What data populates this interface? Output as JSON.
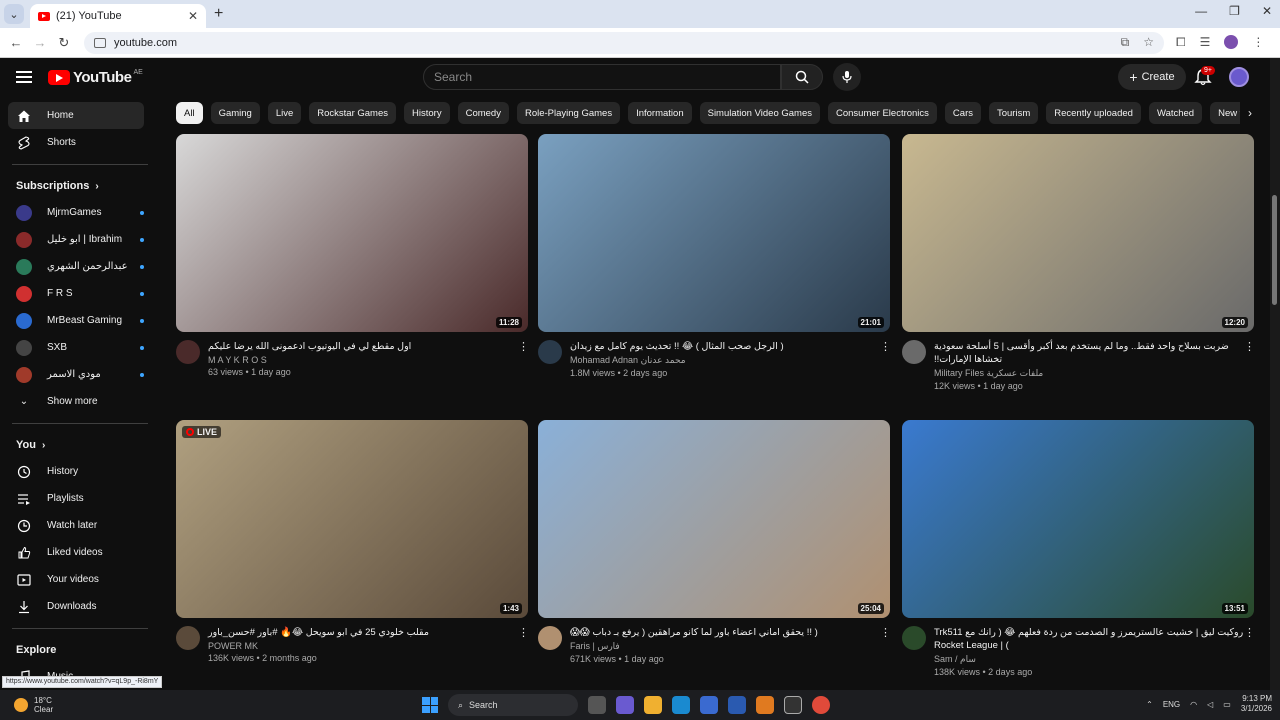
{
  "browser": {
    "tab_title": "(21) YouTube",
    "url": "youtube.com",
    "status_url": "https://www.youtube.com/watch?v=qL9p_-Ri8mY"
  },
  "header": {
    "logo": "YouTube",
    "country": "AE",
    "search_placeholder": "Search",
    "create_label": "Create",
    "notification_count": "9+"
  },
  "sidebar": {
    "main": [
      {
        "label": "Home",
        "icon": "home-icon"
      },
      {
        "label": "Shorts",
        "icon": "shorts-icon"
      }
    ],
    "subscriptions_title": "Subscriptions",
    "subscriptions": [
      {
        "label": "MjrmGames",
        "color": "#3a3a8a"
      },
      {
        "label": "ابو خليل | Ibrahim",
        "color": "#8a2a2a"
      },
      {
        "label": "عبدالرحمن الشهري",
        "color": "#2a7a5a"
      },
      {
        "label": "F R S",
        "color": "#d03030"
      },
      {
        "label": "MrBeast Gaming",
        "color": "#2a6ad0"
      },
      {
        "label": "SXB",
        "color": "#444"
      },
      {
        "label": "مودي الاسمر",
        "color": "#a03a2a"
      }
    ],
    "show_more": "Show more",
    "you_title": "You",
    "you": [
      {
        "label": "History",
        "icon": "history-icon"
      },
      {
        "label": "Playlists",
        "icon": "playlists-icon"
      },
      {
        "label": "Watch later",
        "icon": "watch-later-icon"
      },
      {
        "label": "Liked videos",
        "icon": "like-icon"
      },
      {
        "label": "Your videos",
        "icon": "your-videos-icon"
      },
      {
        "label": "Downloads",
        "icon": "download-icon"
      }
    ],
    "explore_title": "Explore",
    "explore": [
      {
        "label": "Music",
        "icon": "music-icon"
      }
    ]
  },
  "chips": [
    "All",
    "Gaming",
    "Live",
    "Rockstar Games",
    "History",
    "Comedy",
    "Role-Playing Games",
    "Information",
    "Simulation Video Games",
    "Consumer Electronics",
    "Cars",
    "Tourism",
    "Recently uploaded",
    "Watched",
    "New to you"
  ],
  "videos": [
    {
      "title": "اول مقطع لي في اليوتيوب ادعمونى الله يرضا عليكم",
      "channel": "M A Y K R O S",
      "stats": "63 views • 1 day ago",
      "duration": "11:28",
      "colors": [
        "#d8d8d8",
        "#4a2a2a"
      ]
    },
    {
      "title": "( الرجل صحب المثال ) 😂 !! تحديث يوم كامل مع زيدان",
      "channel": "Mohamad Adnan محمد عدنان",
      "stats": "1.8M views • 2 days ago",
      "duration": "21:01",
      "colors": [
        "#7aa0c0",
        "#2a3a4a"
      ]
    },
    {
      "title": "ضربت بسلاح واحد فقط.. وما لم يستخدم بعد أكبر وأقسى | 5 أسلحة سعودية تخشاها الإمارات!!",
      "channel": "Military Files ملفات عسكرية",
      "stats": "12K views • 1 day ago",
      "duration": "12:20",
      "colors": [
        "#c8b890",
        "#6a6a6a"
      ]
    },
    {
      "title": "مقلب خلودي 25 في ابو سويحل 😂🔥 #باور #حسن_باور",
      "channel": "POWER MK",
      "stats": "136K views • 2 months ago",
      "duration": "1:43",
      "live": "LIVE",
      "colors": [
        "#b0a080",
        "#5a4a3a"
      ]
    },
    {
      "title": "( !! يحقق اماني اعضاء باور لما كانو مراهقين ( يرفع بـ دباب 😱😱",
      "channel": "Faris | فارس",
      "stats": "671K views • 1 day ago",
      "duration": "25:04",
      "colors": [
        "#8ab0d8",
        "#b09070"
      ]
    },
    {
      "title": "روكيت ليق | خشيت عالستريمرز و الصدمت من ردة فعلهم 😂 ( رانك مع Trk511 ) | Rocket League",
      "channel": "Sam / سام",
      "stats": "138K views • 2 days ago",
      "duration": "13:51",
      "colors": [
        "#3a7ad0",
        "#2a4a2a"
      ]
    }
  ],
  "taskbar": {
    "temp": "18°C",
    "weather": "Clear",
    "search_label": "Search",
    "lang": "ENG",
    "time": "9:13 PM",
    "date": "3/1/2026"
  }
}
